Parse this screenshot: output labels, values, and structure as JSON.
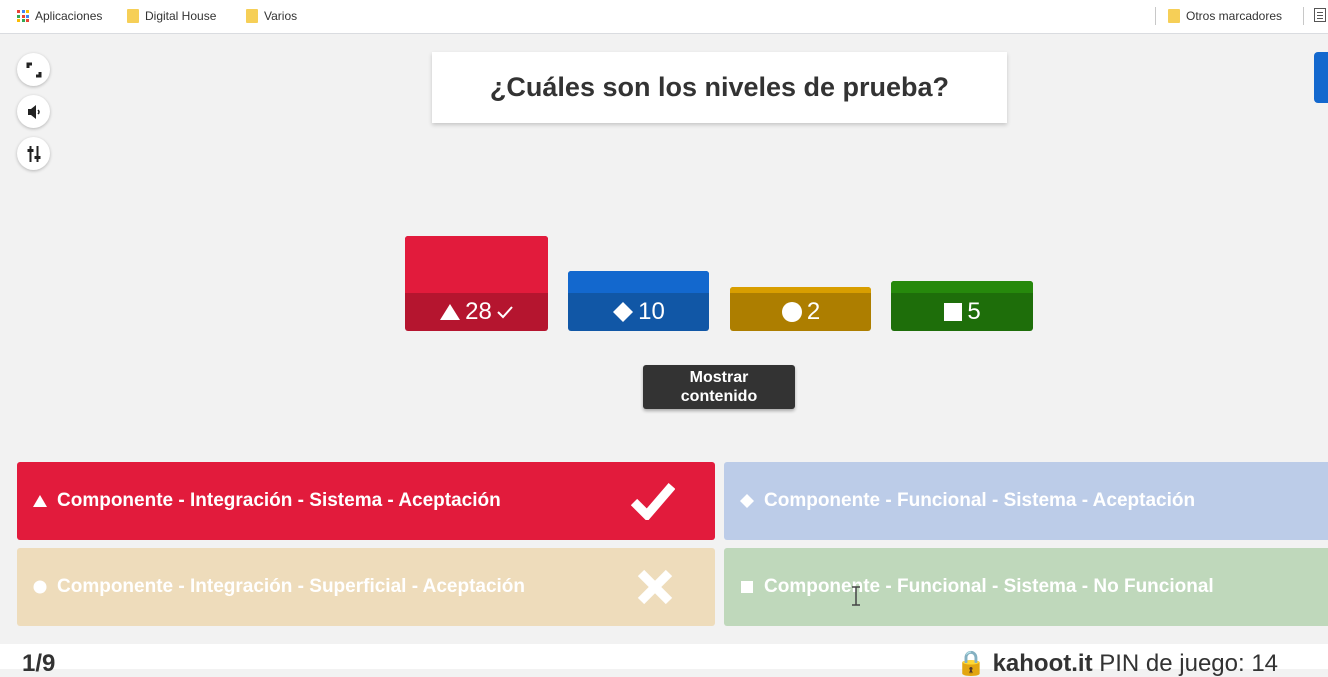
{
  "bookmarks": {
    "apps_label": "Aplicaciones",
    "items": [
      {
        "label": "Digital House"
      },
      {
        "label": "Varios"
      }
    ],
    "other_label": "Otros marcadores"
  },
  "controls": [
    {
      "icon": "fullscreen-icon"
    },
    {
      "icon": "volume-icon"
    },
    {
      "icon": "settings-sliders-icon"
    }
  ],
  "question": "¿Cuáles son los niveles de prueba?",
  "results": [
    {
      "shape": "triangle",
      "count": "28",
      "correct": true,
      "color": "#e21b3c"
    },
    {
      "shape": "diamond",
      "count": "10",
      "correct": false,
      "color": "#1368ce"
    },
    {
      "shape": "circle",
      "count": "2",
      "correct": false,
      "color": "#d89e00"
    },
    {
      "shape": "square",
      "count": "5",
      "correct": false,
      "color": "#26890c"
    }
  ],
  "show_content_label": "Mostrar contenido",
  "answers": [
    {
      "shape": "triangle",
      "text": "Componente - Integración - Sistema - Aceptación",
      "status": "correct",
      "color": "#e21b3c"
    },
    {
      "shape": "diamond",
      "text": "Componente - Funcional - Sistema - Aceptación",
      "status": "dimmed",
      "color": "#bccce8"
    },
    {
      "shape": "circle",
      "text": "Componente - Integración - Superficial - Aceptación",
      "status": "wrong",
      "color": "#eedcbb"
    },
    {
      "shape": "square",
      "text": "Componente - Funcional - Sistema - No Funcional",
      "status": "dimmed",
      "color": "#bfd8bb"
    }
  ],
  "footer": {
    "counter": "1/9",
    "join_site": "kahoot.it",
    "pin_label": "PIN de juego: 14"
  }
}
